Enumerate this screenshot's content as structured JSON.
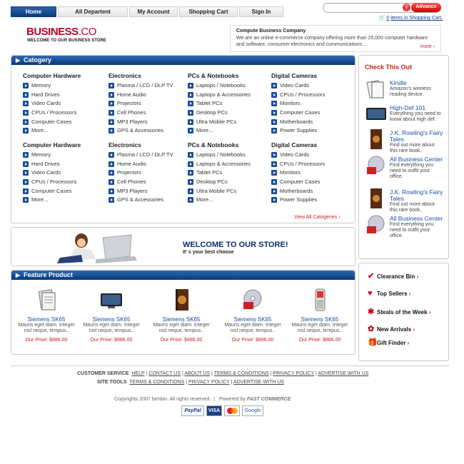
{
  "nav": {
    "tabs": [
      {
        "label": "Home",
        "active": true
      },
      {
        "label": "All Departent",
        "active": false
      },
      {
        "label": "My Account",
        "active": false
      },
      {
        "label": "Shopping Cart",
        "active": false
      },
      {
        "label": "Sign In",
        "active": false
      }
    ],
    "search_placeholder": "",
    "advance_label": "Advance",
    "cart_count": "0",
    "cart_text": "items in Shopping Cart."
  },
  "brand": {
    "logo_main": "BUSINESS",
    "logo_suffix": ".CO",
    "tagline": "WELCOME TO OUR BUSINESS STORE"
  },
  "about": {
    "title": "Compute Business Company",
    "desc": "We are an online e-commerce company offering more than 25,000 computer hardware and software, consumer electronics and communications ...",
    "more": "more"
  },
  "category": {
    "title": "Catogery",
    "columns": [
      {
        "head": "Computer Hardware",
        "items": [
          "Memory",
          "Hard Drives",
          "Video Cards",
          "CPUs / Processors",
          "Computer Cases",
          "More..."
        ]
      },
      {
        "head": "Electronics",
        "items": [
          "Plasma / LCD / DLP TV",
          "Home Audio",
          "Projectors",
          "Cell Phones",
          "MP3 Players",
          "GPS & Accessories"
        ]
      },
      {
        "head": "PCs & Notebooks",
        "items": [
          "Laptops / Notebooks",
          "Laptops & Accessories",
          "Tablet PCs",
          "Desktop PCs",
          "Ultra Mobile PCs",
          "More..."
        ]
      },
      {
        "head": "Digital Cameras",
        "items": [
          "Video Cards",
          "CPUs / Processors",
          "Monitors",
          "Computer Cases",
          "Motherboards",
          "Power Supplies"
        ]
      },
      {
        "head": "Computer Hardware",
        "items": [
          "Memory",
          "Hard Drives",
          "Video Cards",
          "CPUs / Processors",
          "Computer Cases",
          "More..."
        ]
      },
      {
        "head": "Electronics",
        "items": [
          "Plasma / LCD / DLP TV",
          "Home Audio",
          "Projectors",
          "Cell Phones",
          "MP3 Players",
          "GPS & Accessories"
        ]
      },
      {
        "head": "PCs & Notebooks",
        "items": [
          "Laptops / Notebooks",
          "Laptops & Accessories",
          "Tablet PCs",
          "Desktop PCs",
          "Ultra Mobile PCs",
          "More..."
        ]
      },
      {
        "head": "Digital Cameras",
        "items": [
          "Video Cards",
          "CPUs / Processors",
          "Monitors",
          "Computer Cases",
          "Motherboards",
          "Power Supplies"
        ]
      }
    ],
    "view_all": "View All Catogeries"
  },
  "welcome": {
    "title": "WELCOME TO OUR STORE!",
    "subtitle": "It' s your best choose"
  },
  "feature": {
    "title": "Feature Product",
    "products": [
      {
        "name": "Siemens SK65",
        "desc": "Mauris eget diam. Integer nisl neque, tempus..",
        "price": "Our Prise: $886.00",
        "icon": "document-icon"
      },
      {
        "name": "Siemens SK65",
        "desc": "Mauris eget diam. Integer nisl neque, tempus..",
        "price": "Our Prise: $886.00",
        "icon": "tv-icon"
      },
      {
        "name": "Siemens SK65",
        "desc": "Mauris eget diam. Integer nisl neque, tempus..",
        "price": "Our Prise: $886.00",
        "icon": "book-icon"
      },
      {
        "name": "Siemens SK65",
        "desc": "Mauris eget diam. Integer nisl neque, tempus..",
        "price": "Our Prise: $886.00",
        "icon": "cd-icon"
      },
      {
        "name": "Siemens SK65",
        "desc": "Mauris eget diam. Integer nisl neque, tempus..",
        "price": "Our Prise: $886.00",
        "icon": "phone-icon"
      }
    ]
  },
  "checkout": {
    "title": "Check This Out",
    "items": [
      {
        "title": "Kindle",
        "desc": "Amazon's wireless reading device."
      },
      {
        "title": "High-Def 101",
        "desc": "Everything you need to know about high def."
      },
      {
        "title": "J.K. Rowling's Fairy Tales",
        "desc": "Find out more about this rare book."
      },
      {
        "title": "All Business Center",
        "desc": "Find everything you need to outfit your office."
      },
      {
        "title": "J.K. Rowling's Fairy Tales",
        "desc": "Find out more about this rare book."
      },
      {
        "title": "All Business Center",
        "desc": "Find everything you need to outfit your office."
      }
    ]
  },
  "quicklinks": [
    "Clearance Bin",
    "Top Sellers",
    "Steals of the Week",
    "New Arrivals",
    "Gift Finder"
  ],
  "footer": {
    "cs_label": "CUSTOMER SERVICE",
    "cs_links": [
      "HELP",
      "CONTACT US",
      "ABOUT US",
      "TERMS & CONDITIONS",
      "PRIVACY POLICY",
      "ADVERTISE WITH US"
    ],
    "st_label": "SITE TOOLS",
    "st_links": [
      "TERMS & CONDITIONS",
      "PRIVACY POLICY",
      "ADVERTISE WITH US"
    ],
    "copyright": "Copyrights 2007 benbin. All rights reserved.",
    "powered": "Powered by",
    "powered_brand": "FAST COMMERCE",
    "payments": [
      "PayPal",
      "VISA",
      "MasterCard",
      "Google"
    ]
  }
}
